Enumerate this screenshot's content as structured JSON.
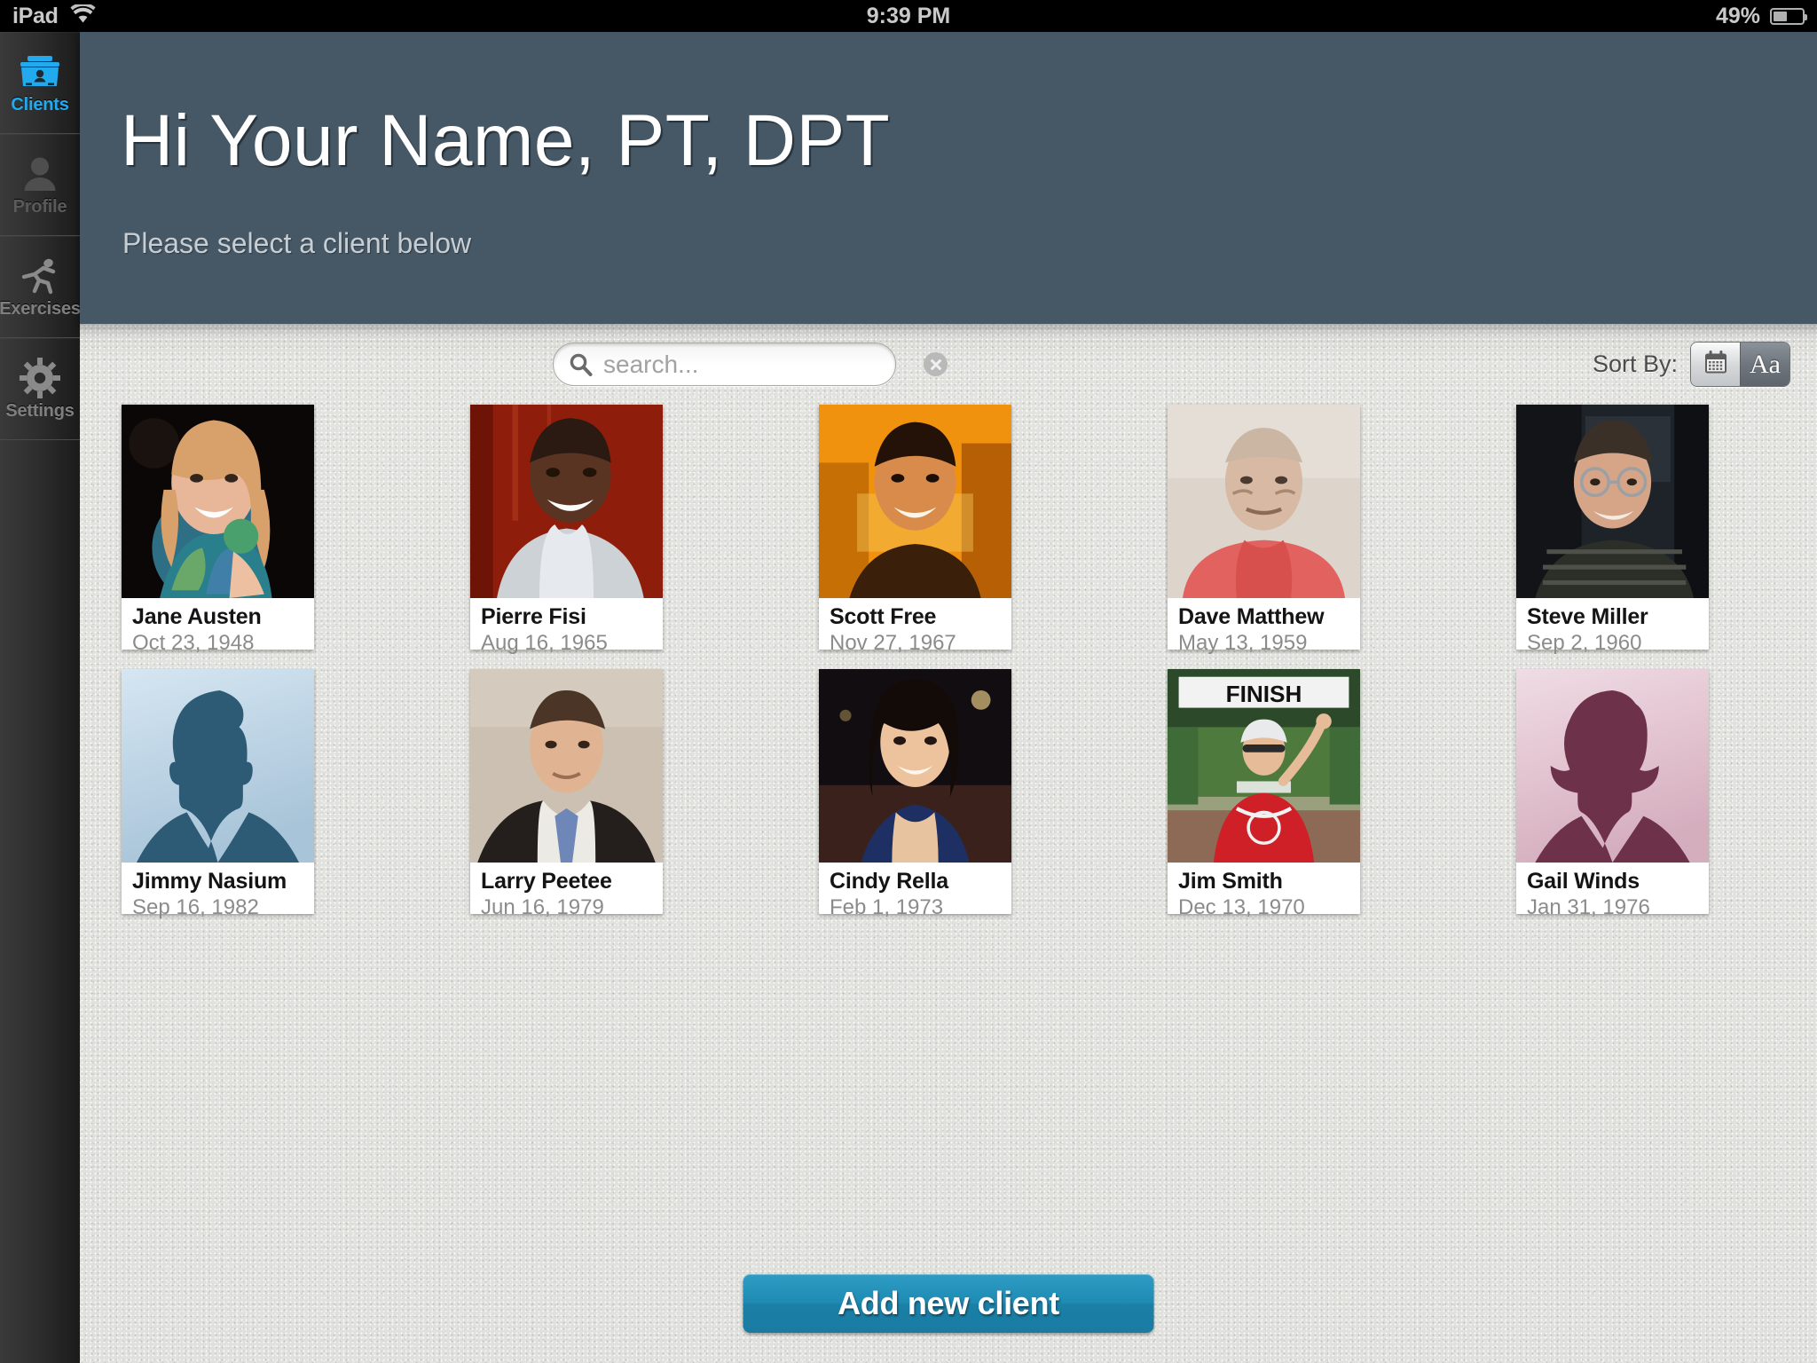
{
  "status_bar": {
    "device": "iPad",
    "wifi_icon": "wifi-icon",
    "time": "9:39 PM",
    "battery_percent": "49%",
    "battery_icon": "battery-icon"
  },
  "sidebar": {
    "items": [
      {
        "label": "Clients",
        "icon": "clients-case-icon",
        "active": true
      },
      {
        "label": "Profile",
        "icon": "person-icon",
        "active": false
      },
      {
        "label": "Exercises",
        "icon": "running-person-icon",
        "active": false
      },
      {
        "label": "Settings",
        "icon": "gear-icon",
        "active": false
      }
    ]
  },
  "header": {
    "greeting": "Hi Your Name, PT, DPT",
    "subtitle": "Please select a client below",
    "background_color": "#465866"
  },
  "toolbar": {
    "search": {
      "icon": "search-icon",
      "value": "",
      "placeholder": "search...",
      "clear_icon": "clear-circle-icon"
    },
    "sort": {
      "label": "Sort By:",
      "options": [
        {
          "name": "date",
          "icon": "calendar-icon",
          "selected": false
        },
        {
          "name": "name",
          "label": "Aa",
          "selected": true
        }
      ]
    }
  },
  "clients": [
    {
      "name": "Jane Austen",
      "dob": "Oct 23, 1948",
      "photo": "photo-woman-blonde-teal-jacket"
    },
    {
      "name": "Pierre Fisi",
      "dob": "Aug 16, 1965",
      "photo": "photo-man-white-shirt-red-background"
    },
    {
      "name": "Scott Free",
      "dob": "Nov 27, 1967",
      "photo": "photo-young-man-orange-light"
    },
    {
      "name": "Dave Matthew",
      "dob": "May 13, 1959",
      "photo": "photo-elderly-man-red-hoodie"
    },
    {
      "name": "Steve Miller",
      "dob": "Sep 2, 1960",
      "photo": "photo-man-glasses-striped-shirt"
    },
    {
      "name": "Jimmy Nasium",
      "dob": "Sep 16, 1982",
      "photo": "placeholder-male-silhouette"
    },
    {
      "name": "Larry Peetee",
      "dob": "Jun 16, 1979",
      "photo": "photo-man-suit-blue-tie"
    },
    {
      "name": "Cindy Rella",
      "dob": "Feb 1, 1973",
      "photo": "photo-woman-dark-hair-blue-top"
    },
    {
      "name": "Jim Smith",
      "dob": "Dec 13, 1970",
      "photo": "photo-cyclist-finish-line"
    },
    {
      "name": "Gail Winds",
      "dob": "Jan 31, 1976",
      "photo": "placeholder-female-silhouette"
    }
  ],
  "footer": {
    "add_button": "Add new client",
    "accent_color": "#1f8bb4"
  }
}
